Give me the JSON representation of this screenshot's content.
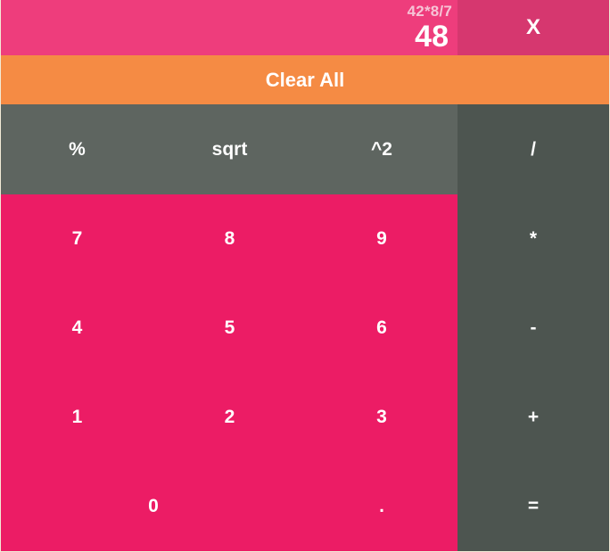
{
  "display": {
    "expression": "42*8/7",
    "result": "48"
  },
  "buttons": {
    "backspace": "X",
    "clear_all": "Clear All",
    "percent": "%",
    "sqrt": "sqrt",
    "square": "^2",
    "divide": "/",
    "multiply": "*",
    "subtract": "-",
    "add": "+",
    "equals": "=",
    "seven": "7",
    "eight": "8",
    "nine": "9",
    "four": "4",
    "five": "5",
    "six": "6",
    "one": "1",
    "two": "2",
    "three": "3",
    "zero": "0",
    "decimal": "."
  },
  "colors": {
    "display_bg": "#ee3d7c",
    "backspace_bg": "#d6376f",
    "clear_bg": "#f58b44",
    "function_bg": "#5e6560",
    "number_bg": "#ec1c65",
    "operator_bg": "#4d5550"
  }
}
